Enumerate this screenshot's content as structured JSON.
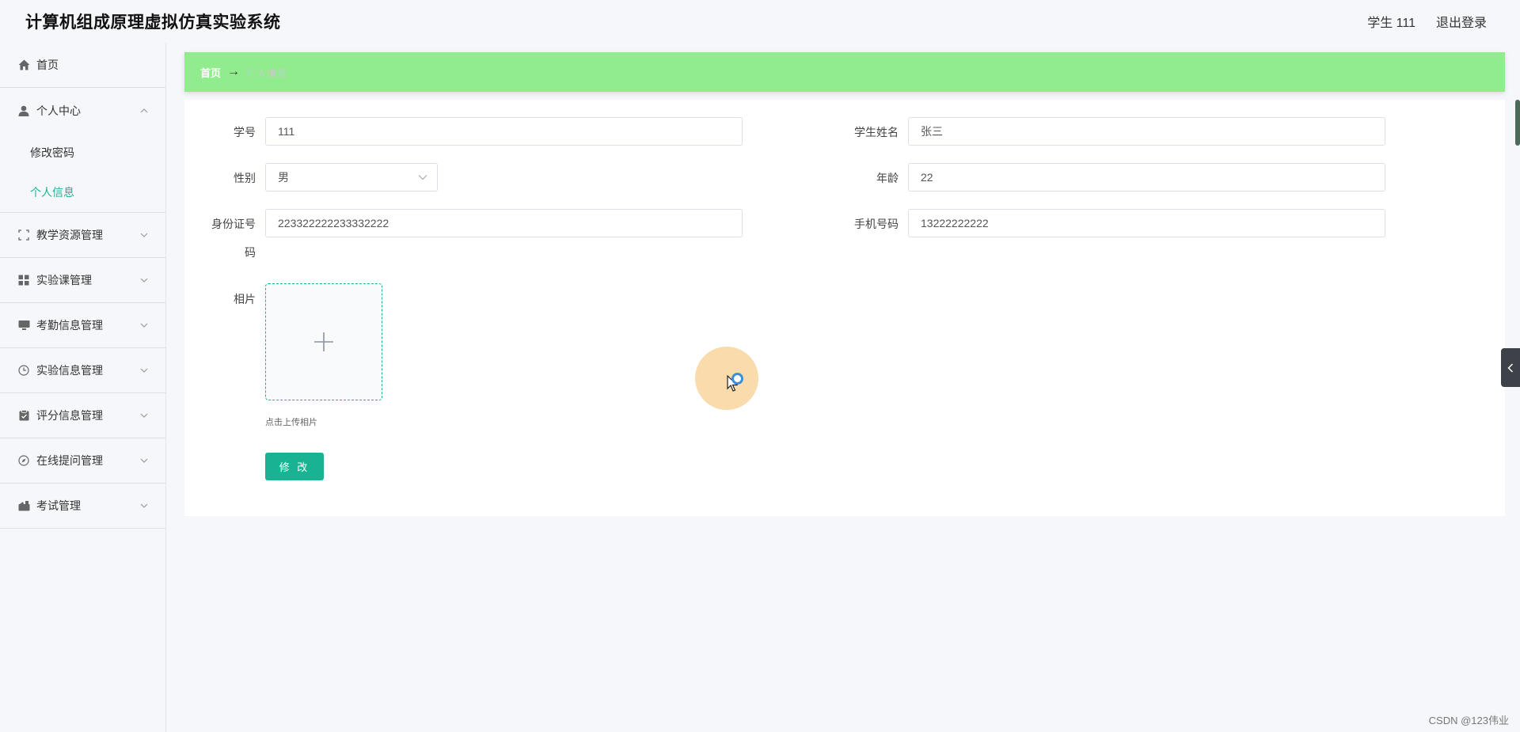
{
  "header": {
    "app_title": "计算机组成原理虚拟仿真实验系统",
    "user_label": "学生 111",
    "logout_label": "退出登录"
  },
  "sidebar": {
    "items": [
      {
        "label": "首页",
        "icon": "home-icon"
      },
      {
        "label": "个人中心",
        "icon": "user-icon",
        "expanded": true,
        "children": [
          {
            "label": "修改密码",
            "active": false
          },
          {
            "label": "个人信息",
            "active": true
          }
        ]
      },
      {
        "label": "教学资源管理",
        "icon": "fullscreen-icon"
      },
      {
        "label": "实验课管理",
        "icon": "grid-icon"
      },
      {
        "label": "考勤信息管理",
        "icon": "monitor-icon"
      },
      {
        "label": "实验信息管理",
        "icon": "clock-icon"
      },
      {
        "label": "评分信息管理",
        "icon": "clipboard-icon"
      },
      {
        "label": "在线提问管理",
        "icon": "compass-icon"
      },
      {
        "label": "考试管理",
        "icon": "briefcase-icon"
      }
    ]
  },
  "breadcrumb": {
    "home": "首页",
    "separator": "→",
    "current": "个人信息"
  },
  "form": {
    "student_id": {
      "label": "学号",
      "value": "111"
    },
    "student_name": {
      "label": "学生姓名",
      "value": "张三"
    },
    "gender": {
      "label": "性别",
      "value": "男"
    },
    "age": {
      "label": "年龄",
      "value": "22"
    },
    "id_card": {
      "label_line1": "身份证号",
      "label_line2": "码",
      "value": "223322222233332222"
    },
    "phone": {
      "label": "手机号码",
      "value": "13222222222"
    },
    "photo": {
      "label": "相片",
      "tip": "点击上传相片"
    },
    "submit_label": "修 改"
  },
  "watermark": "CSDN @123伟业",
  "colors": {
    "accent": "#19b394",
    "breadcrumb_bg": "#90ec8d",
    "background": "#f6f7fb"
  }
}
